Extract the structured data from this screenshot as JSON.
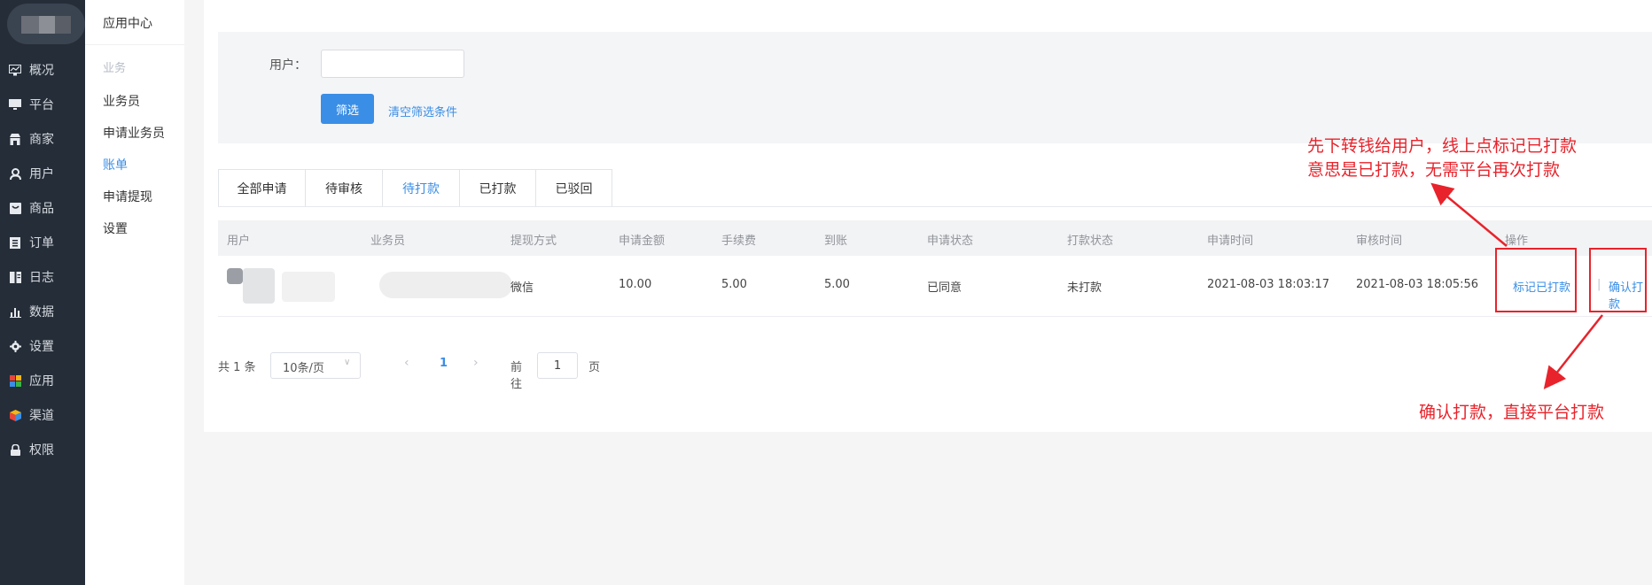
{
  "left_nav": {
    "items": [
      {
        "label": "概况",
        "icon": "monitor-chart-icon"
      },
      {
        "label": "平台",
        "icon": "monitor-icon"
      },
      {
        "label": "商家",
        "icon": "store-icon"
      },
      {
        "label": "用户",
        "icon": "user-icon"
      },
      {
        "label": "商品",
        "icon": "goods-icon"
      },
      {
        "label": "订单",
        "icon": "order-icon"
      },
      {
        "label": "日志",
        "icon": "log-icon"
      },
      {
        "label": "数据",
        "icon": "bar-chart-icon"
      },
      {
        "label": "设置",
        "icon": "gear-icon"
      },
      {
        "label": "应用",
        "icon": "apps-grid-icon"
      },
      {
        "label": "渠道",
        "icon": "cube-icon"
      },
      {
        "label": "权限",
        "icon": "lock-icon"
      }
    ]
  },
  "sub_nav": {
    "title": "应用中心",
    "group": "业务",
    "items": [
      {
        "label": "业务员"
      },
      {
        "label": "申请业务员"
      },
      {
        "label": "账单"
      },
      {
        "label": "申请提现"
      },
      {
        "label": "设置"
      }
    ],
    "active_index": 2
  },
  "filter": {
    "user_label": "用户：",
    "user_value": "",
    "submit_label": "筛选",
    "clear_label": "清空筛选条件"
  },
  "tabs": [
    {
      "label": "全部申请"
    },
    {
      "label": "待审核"
    },
    {
      "label": "待打款"
    },
    {
      "label": "已打款"
    },
    {
      "label": "已驳回"
    }
  ],
  "active_tab": 2,
  "table": {
    "headers": [
      "用户",
      "业务员",
      "提现方式",
      "申请金额",
      "手续费",
      "到账",
      "申请状态",
      "打款状态",
      "申请时间",
      "审核时间",
      "操作"
    ],
    "rows": [
      {
        "method": "微信",
        "amount": "10.00",
        "fee": "5.00",
        "received": "5.00",
        "apply_status": "已同意",
        "pay_status": "未打款",
        "apply_time": "2021-08-03 18:03:17",
        "review_time": "2021-08-03 18:05:56",
        "actions": {
          "mark_paid": "标记已打款",
          "separator": "|",
          "confirm_pay": "确认打款"
        }
      }
    ]
  },
  "pagination": {
    "total": "共 1 条",
    "page_size": "10条/页",
    "prev": "‹",
    "current": "1",
    "next": "›",
    "goto_prefix": "前往",
    "goto_value": "1",
    "goto_suffix": "页"
  },
  "annotations": {
    "top_line1": "先下转钱给用户，线上点标记已打款",
    "top_line2": "意思是已打款，无需平台再次打款",
    "bottom": "确认打款，直接平台打款"
  },
  "colors": {
    "sidebar_bg": "#252d38",
    "accent": "#3a8ee6",
    "annotation_red": "#e8232b"
  }
}
